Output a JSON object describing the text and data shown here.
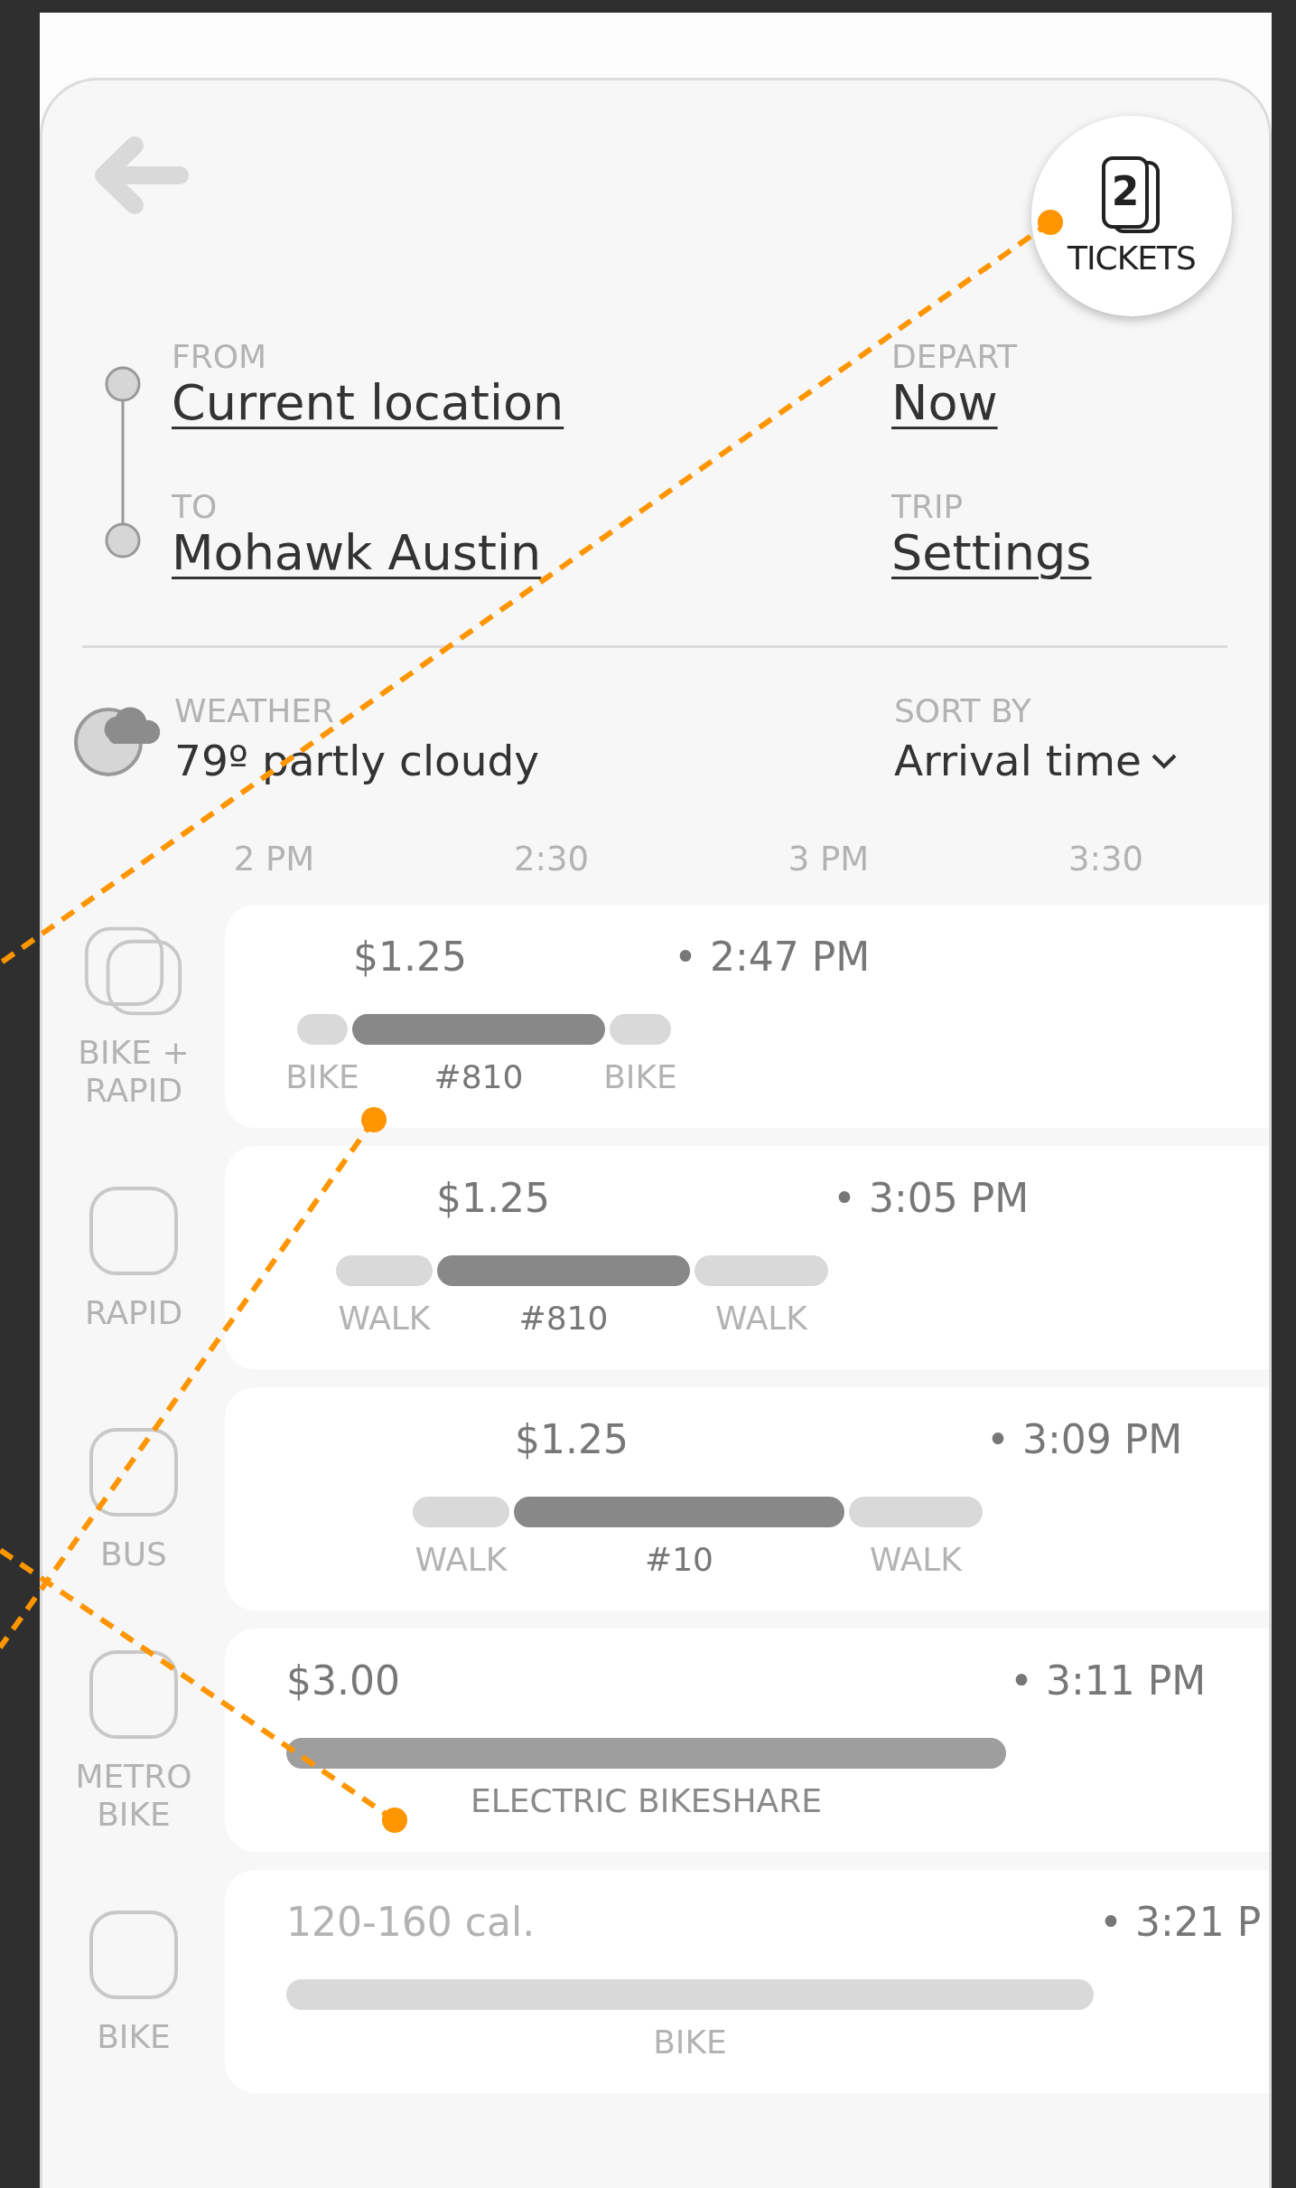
{
  "tickets": {
    "count": "2",
    "label": "TICKETS"
  },
  "trip": {
    "from": {
      "label": "FROM",
      "value": "Current location"
    },
    "to": {
      "label": "TO",
      "value": "Mohawk Austin"
    },
    "depart": {
      "label": "DEPART",
      "value": "Now"
    },
    "settings": {
      "label": "TRIP",
      "value": "Settings"
    }
  },
  "weather": {
    "label": "WEATHER",
    "value": "79º partly cloudy"
  },
  "sort": {
    "label": "SORT BY",
    "value": "Arrival time"
  },
  "time_axis": [
    "2 PM",
    "2:30",
    "3 PM",
    "3:30"
  ],
  "options": [
    {
      "mode": "BIKE + RAPID",
      "kind": "double",
      "price": "$1.25",
      "arrival": "• 2:47 PM",
      "segments": [
        {
          "kind": "access",
          "label": "BIKE"
        },
        {
          "kind": "transit",
          "label": "#810"
        },
        {
          "kind": "access",
          "label": "BIKE"
        }
      ]
    },
    {
      "mode": "RAPID",
      "kind": "single",
      "price": "$1.25",
      "arrival": "• 3:05 PM",
      "segments": [
        {
          "kind": "access",
          "label": "WALK"
        },
        {
          "kind": "transit",
          "label": "#810"
        },
        {
          "kind": "access",
          "label": "WALK"
        }
      ]
    },
    {
      "mode": "BUS",
      "kind": "single",
      "price": "$1.25",
      "arrival": "• 3:09 PM",
      "segments": [
        {
          "kind": "access",
          "label": "WALK"
        },
        {
          "kind": "transit",
          "label": "#10"
        },
        {
          "kind": "access",
          "label": "WALK"
        }
      ]
    },
    {
      "mode": "METRO BIKE",
      "kind": "single",
      "price": "$3.00",
      "arrival": "• 3:11 PM",
      "segments": [
        {
          "kind": "bikeshare",
          "label": "ELECTRIC BIKESHARE"
        }
      ]
    },
    {
      "mode": "BIKE",
      "kind": "single",
      "calories": "120-160 cal.",
      "arrival": "• 3:21 P",
      "segments": [
        {
          "kind": "access",
          "label": "BIKE"
        }
      ]
    }
  ]
}
